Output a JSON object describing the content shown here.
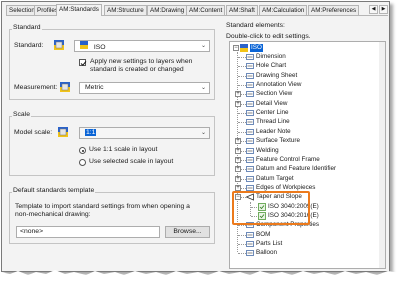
{
  "tabs": [
    {
      "label": "Selection"
    },
    {
      "label": "Profiles"
    },
    {
      "label": "AM:Standards"
    },
    {
      "label": "AM:Structure"
    },
    {
      "label": "AM:Drawing"
    },
    {
      "label": "AM:Content"
    },
    {
      "label": "AM:Shaft"
    },
    {
      "label": "AM:Calculation"
    },
    {
      "label": "AM:Preferences"
    }
  ],
  "tab_nav": {
    "prev": "◀",
    "next": "▶"
  },
  "standard_group": {
    "title": "Standard",
    "standard_label": "Standard:",
    "standard_value": "ISO",
    "apply_checkbox_label_1": "Apply new settings to layers when",
    "apply_checkbox_label_2": "standard is created or changed",
    "apply_checked": true,
    "measurement_label": "Measurement:",
    "measurement_value": "Metric"
  },
  "scale_group": {
    "title": "Scale",
    "model_scale_label": "Model scale:",
    "model_scale_value": "1:1",
    "radio_use_1to1": "Use 1:1 scale in layout",
    "radio_use_selected": "Use selected scale in layout",
    "selected_radio": "use_1to1"
  },
  "template_group": {
    "title": "Default standards template",
    "description_1": "Template to import standard settings from when opening a",
    "description_2": "non-mechanical drawing:",
    "value": "<none>",
    "browse_label": "Browse..."
  },
  "elements_panel": {
    "title": "Standard elements:",
    "hint": "Double-click to edit settings.",
    "root": "ISO",
    "items": [
      {
        "label": "Dimension",
        "expander": "",
        "icon": "dimension-icon"
      },
      {
        "label": "Hole Chart",
        "expander": "",
        "icon": "hole-chart-icon"
      },
      {
        "label": "Drawing Sheet",
        "expander": "",
        "icon": "drawing-sheet-icon"
      },
      {
        "label": "Annotation View",
        "expander": "",
        "icon": "annotation-view-icon"
      },
      {
        "label": "Section View",
        "expander": "+",
        "icon": "section-view-icon"
      },
      {
        "label": "Detail View",
        "expander": "+",
        "icon": "detail-view-icon"
      },
      {
        "label": "Center Line",
        "expander": "",
        "icon": "center-line-icon"
      },
      {
        "label": "Thread Line",
        "expander": "",
        "icon": "thread-line-icon"
      },
      {
        "label": "Leader Note",
        "expander": "",
        "icon": "leader-note-icon"
      },
      {
        "label": "Surface Texture",
        "expander": "+",
        "icon": "surface-texture-icon"
      },
      {
        "label": "Welding",
        "expander": "+",
        "icon": "welding-icon"
      },
      {
        "label": "Feature Control Frame",
        "expander": "+",
        "icon": "feature-control-frame-icon"
      },
      {
        "label": "Datum and Feature Identifier",
        "expander": "+",
        "icon": "datum-feature-identifier-icon"
      },
      {
        "label": "Datum Target",
        "expander": "+",
        "icon": "datum-target-icon"
      },
      {
        "label": "Edges of Workpieces",
        "expander": "+",
        "icon": "edges-of-workpieces-icon"
      },
      {
        "label": "Taper and Slope",
        "expander": "−",
        "icon": "taper-slope-icon"
      },
      {
        "label": "Component Properties",
        "expander": "",
        "icon": "component-properties-icon"
      },
      {
        "label": "BOM",
        "expander": "",
        "icon": "bom-icon"
      },
      {
        "label": "Parts List",
        "expander": "",
        "icon": "parts-list-icon"
      },
      {
        "label": "Balloon",
        "expander": "",
        "icon": "balloon-icon"
      }
    ],
    "taper_children": [
      {
        "label": "ISO 3040:2009(E)"
      },
      {
        "label": "ISO 3040:2016(E)"
      }
    ],
    "highlight_color": "#ec7a1c"
  }
}
